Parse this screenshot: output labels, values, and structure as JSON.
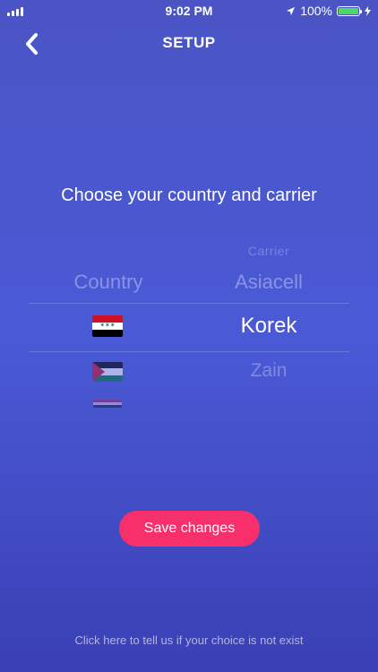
{
  "status_bar": {
    "time": "9:02 PM",
    "battery_percent": "100%",
    "battery_level": 1.0,
    "location_icon": "location-arrow-icon",
    "charging_icon": "bolt-icon"
  },
  "nav": {
    "title": "SETUP",
    "back_icon": "chevron-left-icon"
  },
  "prompt": "Choose your country and carrier",
  "picker": {
    "country_header": "Country",
    "carrier_header": "Carrier",
    "countries": [
      {
        "flag": "iraq-flag-icon",
        "selected": true
      },
      {
        "flag": "jordan-flag-icon",
        "selected": false
      },
      {
        "flag": "flag-icon",
        "selected": false
      }
    ],
    "carriers": [
      {
        "label": "Asiacell",
        "selected": false
      },
      {
        "label": "Korek",
        "selected": true
      },
      {
        "label": "Zain",
        "selected": false
      }
    ]
  },
  "save_button": "Save changes",
  "footer_link": "Click here to tell us if your choice is not exist",
  "colors": {
    "accent": "#f7306b",
    "background_top": "#4a54c4",
    "background_bottom": "#3a3fb4",
    "battery": "#4cd964"
  }
}
